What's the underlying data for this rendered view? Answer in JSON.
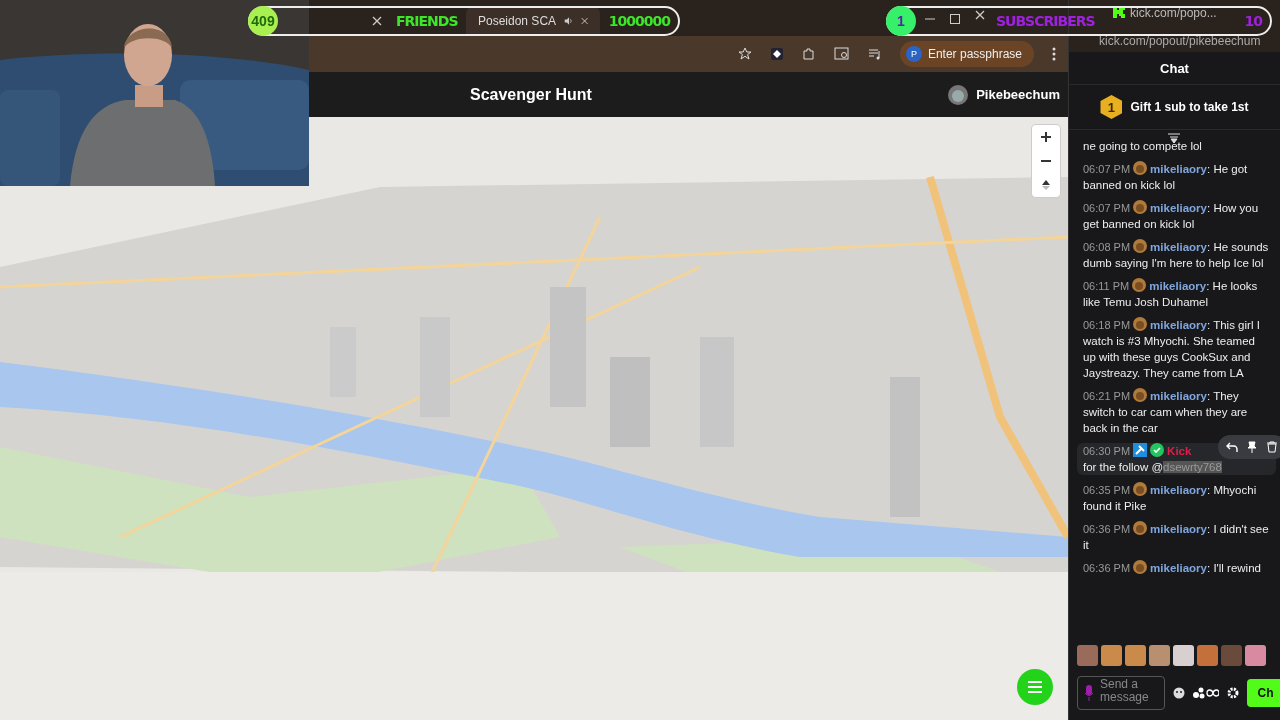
{
  "stream_overlays": [
    {
      "count": "409",
      "label": "FRIENDS",
      "goal": "1000000",
      "color": "#3ee62a"
    },
    {
      "count": "1",
      "label": "SUBSCRIBERS",
      "goal": "10",
      "color": "#a020e0"
    }
  ],
  "browser": {
    "tabs": [
      {
        "selected": false,
        "audio": false
      },
      {
        "title": "Poseidon SCA",
        "selected": true,
        "audio": true
      }
    ],
    "passphrase_button": "Enter passphrase",
    "profile_initial": "P"
  },
  "app_header": {
    "title": "Scavenger Hunt",
    "user": "Pikebeechum"
  },
  "chat_window": {
    "tab_title": "kick.com/popo...",
    "address": "kick.com/popout/pikebeechum",
    "header": "Chat",
    "gift": {
      "rank": "1",
      "text": "Gift 1 sub to take 1st"
    },
    "messages": [
      {
        "kind": "continued",
        "text": "ne going to compete lol"
      },
      {
        "kind": "user",
        "time": "06:07 PM",
        "user": "mikeliaory",
        "text": ": He got banned on kick lol"
      },
      {
        "kind": "user",
        "time": "06:07 PM",
        "user": "mikeliaory",
        "text": ": How you get banned on kick lol"
      },
      {
        "kind": "user",
        "time": "06:08 PM",
        "user": "mikeliaory",
        "text": ": He sounds dumb saying I'm here to help Ice lol"
      },
      {
        "kind": "user",
        "time": "06:11 PM",
        "user": "mikeliaory",
        "text": ": He looks like Temu Josh Duhamel"
      },
      {
        "kind": "user",
        "time": "06:18 PM",
        "user": "mikeliaory",
        "text": ": This girl I watch is #3 Mhyochi. She teamed up with these guys CookSux and Jaystreazy. They came from LA"
      },
      {
        "kind": "user",
        "time": "06:21 PM",
        "user": "mikeliaory",
        "text": ": They switch to car cam when they are back in the car"
      },
      {
        "kind": "bot",
        "time": "06:30 PM",
        "user": "Kick",
        "text": "for the follow @",
        "mention": "dsewrty768",
        "hovered": true
      },
      {
        "kind": "user",
        "time": "06:35 PM",
        "user": "mikeliaory",
        "text": ": Mhyochi found it Pike"
      },
      {
        "kind": "user",
        "time": "06:36 PM",
        "user": "mikeliaory",
        "text": ": I didn't see it"
      },
      {
        "kind": "user",
        "time": "06:36 PM",
        "user": "mikeliaory",
        "text": ": I'll rewind"
      }
    ],
    "emotes": [
      {
        "color": "#9a6b5a"
      },
      {
        "color": "#c98a4a"
      },
      {
        "color": "#c98a4a"
      },
      {
        "color": "#b89070"
      },
      {
        "color": "#d8d0d0"
      },
      {
        "color": "#c4703a"
      },
      {
        "color": "#6a4a3a"
      },
      {
        "color": "#d88aa0"
      }
    ],
    "input_placeholder": "Send a message",
    "send_button": "Ch"
  }
}
